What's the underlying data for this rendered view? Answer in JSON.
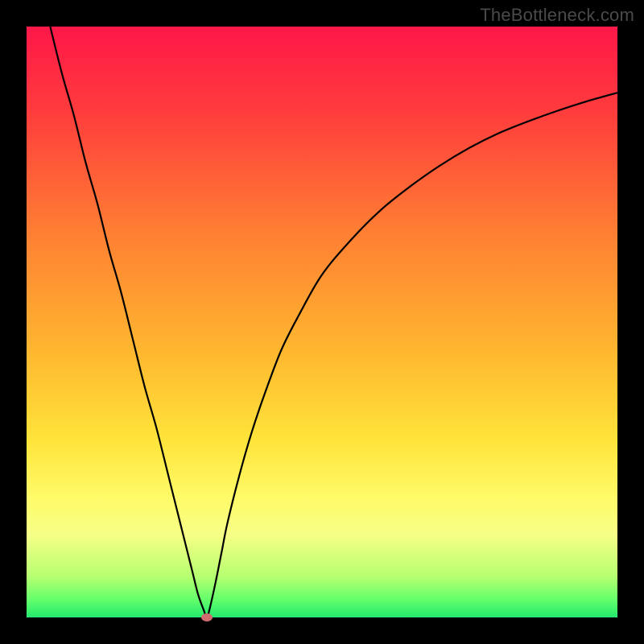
{
  "watermark": {
    "text": "TheBottleneck.com"
  },
  "colors": {
    "frame": "#000000",
    "curve": "#000000",
    "marker": "#cf6a6e",
    "gradient_stops": [
      {
        "pct": 0,
        "color": "#ff1748"
      },
      {
        "pct": 14,
        "color": "#ff3b3d"
      },
      {
        "pct": 35,
        "color": "#ff7f33"
      },
      {
        "pct": 55,
        "color": "#ffb72f"
      },
      {
        "pct": 70,
        "color": "#ffe43a"
      },
      {
        "pct": 80,
        "color": "#fffb6a"
      },
      {
        "pct": 86,
        "color": "#f6ff86"
      },
      {
        "pct": 93,
        "color": "#b7ff70"
      },
      {
        "pct": 97,
        "color": "#63ff6b"
      },
      {
        "pct": 100,
        "color": "#23e86d"
      }
    ]
  },
  "chart_data": {
    "type": "line",
    "title": "",
    "xlabel": "",
    "ylabel": "",
    "xlim": [
      0,
      100
    ],
    "ylim": [
      0,
      100
    ],
    "marker": {
      "x": 30.5,
      "y": 0
    },
    "series": [
      {
        "name": "bottleneck-curve",
        "x": [
          4.0,
          6,
          8,
          10,
          12,
          14,
          16,
          18,
          20,
          22,
          24,
          26,
          28,
          29,
          30,
          30.5,
          31,
          32,
          33,
          34,
          36,
          38,
          40,
          43,
          46,
          50,
          55,
          60,
          65,
          70,
          75,
          80,
          85,
          90,
          95,
          100
        ],
        "values": [
          100,
          92,
          85,
          77,
          70,
          62,
          55,
          47,
          39,
          32,
          24,
          16,
          8,
          4,
          1.2,
          0,
          1.5,
          6,
          11,
          16,
          24,
          31,
          37,
          45,
          51,
          58,
          64,
          69,
          73,
          76.5,
          79.5,
          82,
          84,
          85.8,
          87.4,
          88.8
        ]
      }
    ]
  }
}
